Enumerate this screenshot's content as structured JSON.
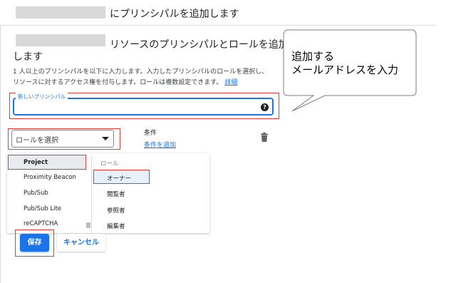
{
  "header": {
    "title": "にプリンシパルを追加します"
  },
  "panel": {
    "title_part1": "リソースのプリンシパルとロールを追加",
    "title_part2": "します",
    "description": "1 人以上のプリンシパルを以下に入力します。入力したプリンシパルのロールを選択し、リソースに対するアクセス権を付与します。ロールは複数設定できます。",
    "details_link": "詳細"
  },
  "principal_input": {
    "label": "新しいプリンシパル",
    "value": "",
    "help_icon": "help-circle-icon"
  },
  "role_select": {
    "placeholder": "ロールを選択"
  },
  "condition": {
    "label": "条件",
    "add_link": "条件を追加",
    "delete_icon": "trash-icon"
  },
  "role_menu": {
    "services": [
      "Project",
      "Proximity Beacon",
      "Pub/Sub",
      "Pub/Sub Lite",
      "reCAPTCHA"
    ],
    "selected_service": "Project",
    "roles_header": "ロール",
    "roles": [
      "オーナー",
      "閲覧者",
      "参照者",
      "編集者"
    ],
    "highlighted_role": "オーナー"
  },
  "actions": {
    "save_label": "保存",
    "cancel_label": "キャンセル"
  },
  "callout": {
    "line1": "追加する",
    "line2": "メールアドレスを入力"
  },
  "colors": {
    "accent": "#1a73e8",
    "annotation_red": "#e53935"
  }
}
